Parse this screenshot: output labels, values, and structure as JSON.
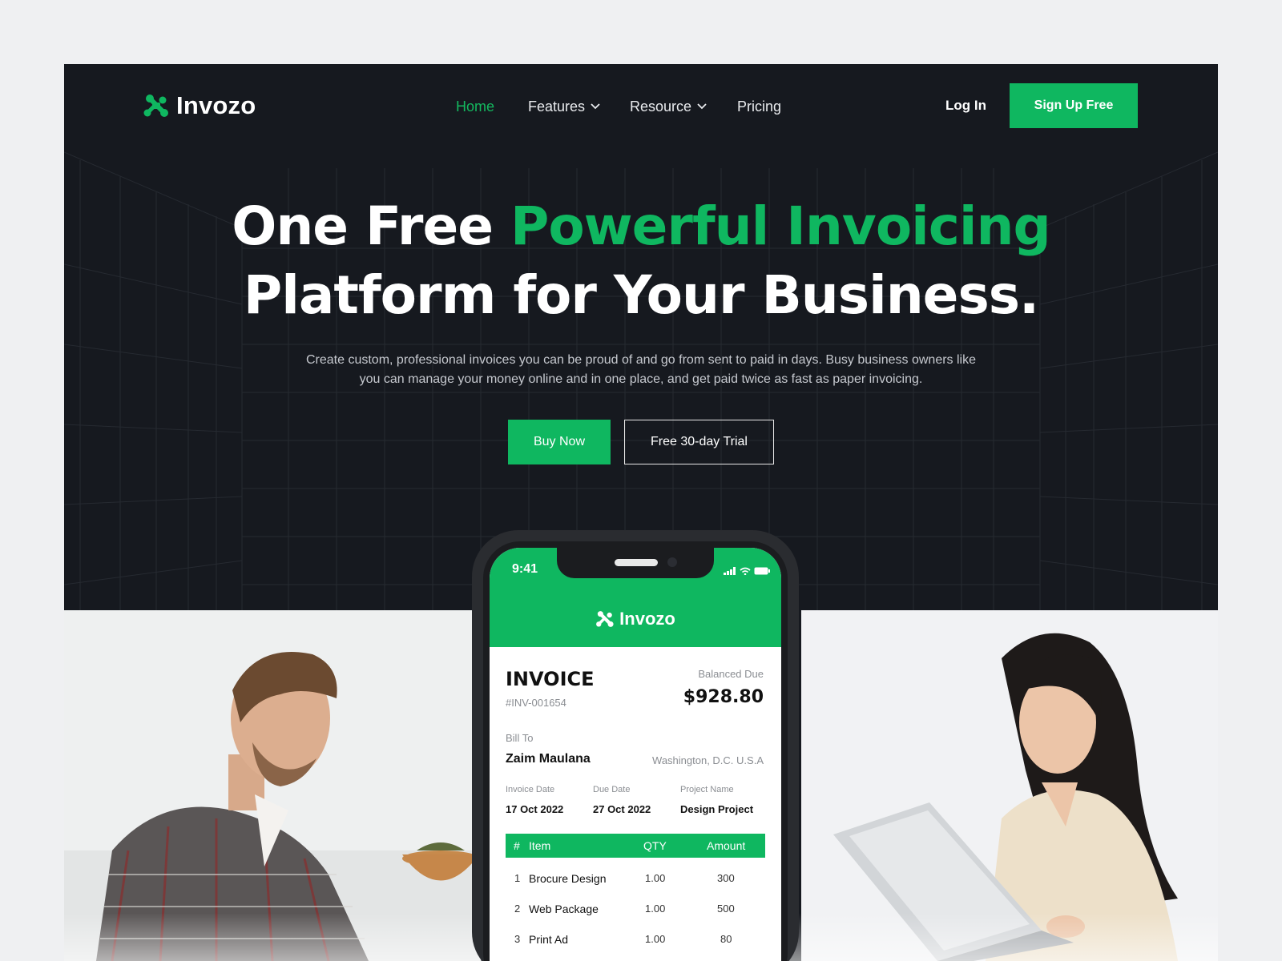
{
  "nav": {
    "logo": "Invozo",
    "items": [
      {
        "label": "Home",
        "active": true
      },
      {
        "label": "Features",
        "dropdown": true
      },
      {
        "label": "Resource",
        "dropdown": true
      },
      {
        "label": "Pricing"
      }
    ],
    "login": "Log In",
    "signup": "Sign Up Free"
  },
  "hero": {
    "headline_white_1": "One Free ",
    "headline_green": "Powerful Invoicing",
    "headline_line_2": "Platform for Your Business.",
    "subtext": "Create custom, professional invoices you can be proud of and go from sent to paid in days. Busy business owners like you can manage your money online and in one place, and get paid twice as fast as paper invoicing.",
    "buy_button": "Buy Now",
    "trial_button": "Free 30-day Trial"
  },
  "phone": {
    "time": "9:41",
    "app_name": "Invozo",
    "invoice_title": "INVOICE",
    "invoice_number": "#INV-001654",
    "balance_label": "Balanced Due",
    "balance_amount": "$928.80",
    "bill_to_label": "Bill To",
    "bill_to_name": "Zaim Maulana",
    "bill_to_location": "Washington, D.C. U.S.A",
    "invoice_date_label": "Invoice Date",
    "invoice_date": "17 Oct 2022",
    "due_date_label": "Due Date",
    "due_date": "27 Oct 2022",
    "project_label": "Project Name",
    "project_name": "Design Project",
    "table": {
      "headers": {
        "num": "#",
        "item": "Item",
        "qty": "QTY",
        "amount": "Amount"
      },
      "rows": [
        {
          "num": "1",
          "item": "Brocure Design",
          "qty": "1.00",
          "amount": "300"
        },
        {
          "num": "2",
          "item": "Web Package",
          "qty": "1.00",
          "amount": "500"
        },
        {
          "num": "3",
          "item": "Print Ad",
          "qty": "1.00",
          "amount": "80"
        }
      ]
    }
  },
  "colors": {
    "brand_green": "#0fb760",
    "dark_bg": "#16191f",
    "page_bg": "#eff0f2"
  }
}
